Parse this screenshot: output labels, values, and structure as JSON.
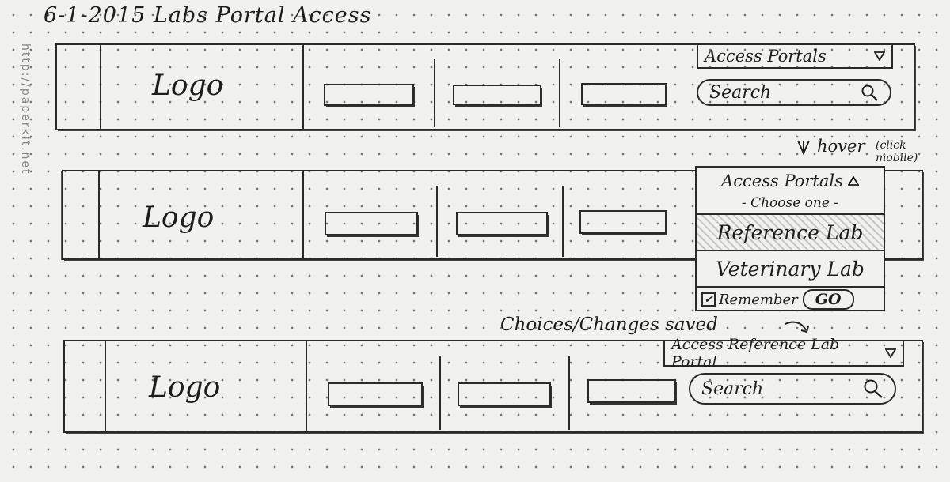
{
  "sheet": {
    "title": "6-1-2015   Labs Portal Access",
    "side_url": "http://paperkit.net"
  },
  "annotations": {
    "hover": "hover",
    "hover_note": "(click mobile)",
    "saved": "Choices/Changes saved"
  },
  "frame1": {
    "logo": "Logo",
    "dropdown_label": "Access Portals",
    "search_placeholder": "Search"
  },
  "frame2": {
    "logo": "Logo",
    "dropdown_label": "Access Portals",
    "choose": "- Choose one -",
    "options": [
      "Reference Lab",
      "Veterinary Lab"
    ],
    "remember_label": "Remember",
    "remember_checked": true,
    "go_label": "GO"
  },
  "frame3": {
    "logo": "Logo",
    "dropdown_label": "Access Reference Lab Portal",
    "search_placeholder": "Search"
  },
  "icons": {
    "dropdown": "triangle-down-icon",
    "dropup": "triangle-up-icon",
    "search": "magnifier-icon",
    "arrow": "curved-arrow-icon"
  }
}
